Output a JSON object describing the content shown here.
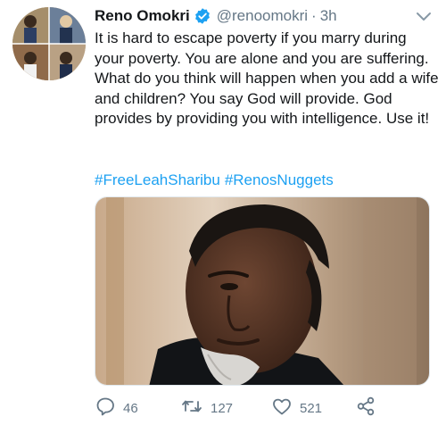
{
  "tweet": {
    "display_name": "Reno Omokri",
    "handle": "@renoomokri",
    "separator": "·",
    "time": "3h",
    "verified": true,
    "text": "It is hard to escape poverty if you marry during your poverty. You are alone and you are suffering. What do you think will happen when you add a wife and children? You say God will provide. God provides by providing you with intelligence. Use it!",
    "hashtags": [
      "#FreeLeahSharibu",
      "#RenosNuggets"
    ]
  },
  "actions": {
    "replies": "46",
    "retweets": "127",
    "likes": "521"
  },
  "icons": {
    "verified": "verified-badge-icon",
    "caret": "chevron-down-icon",
    "reply": "reply-icon",
    "retweet": "retweet-icon",
    "like": "heart-icon",
    "share": "share-icon"
  },
  "colors": {
    "accent": "#1da1f2",
    "text": "#14171a",
    "secondary": "#657786"
  }
}
